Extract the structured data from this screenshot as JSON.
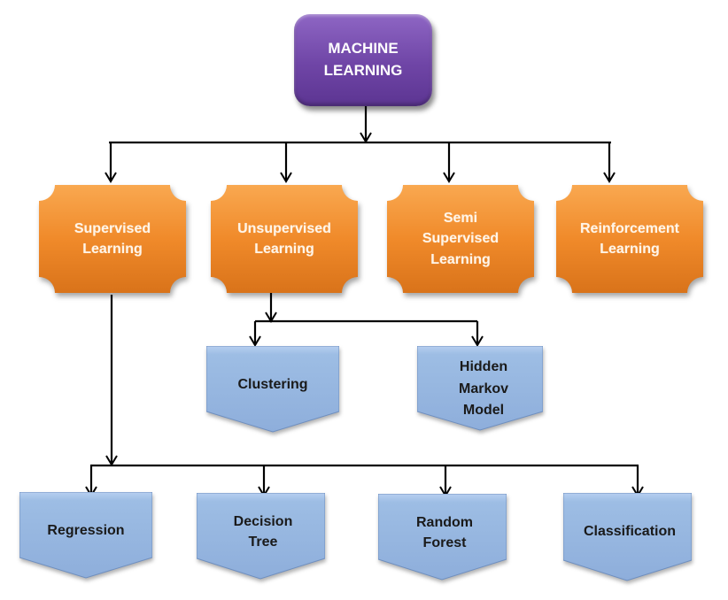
{
  "diagram": {
    "type": "hierarchy",
    "root": {
      "id": "ml",
      "label": "MACHINE\nLEARNING",
      "color": "#7c52b4"
    },
    "categories": [
      {
        "id": "supervised",
        "label": "Supervised\nLearning",
        "color": "#f08a2a"
      },
      {
        "id": "unsupervised",
        "label": "Unsupervised\nLearning",
        "color": "#f08a2a"
      },
      {
        "id": "semi",
        "label": "Semi\nSupervised\nLearning",
        "color": "#f08a2a"
      },
      {
        "id": "reinforcement",
        "label": "Reinforcement\nLearning",
        "color": "#f08a2a"
      }
    ],
    "unsupervised_children": [
      {
        "id": "clustering",
        "label": "Clustering",
        "color": "#9dbde4"
      },
      {
        "id": "hmm",
        "label": "Hidden\nMarkov\nModel",
        "color": "#9dbde4"
      }
    ],
    "supervised_children": [
      {
        "id": "regression",
        "label": "Regression",
        "color": "#9dbde4"
      },
      {
        "id": "decision-tree",
        "label": "Decision\nTree",
        "color": "#9dbde4"
      },
      {
        "id": "random-forest",
        "label": "Random\nForest",
        "color": "#9dbde4"
      },
      {
        "id": "classification",
        "label": "Classification",
        "color": "#9dbde4"
      }
    ],
    "edges": [
      [
        "ml",
        "supervised"
      ],
      [
        "ml",
        "unsupervised"
      ],
      [
        "ml",
        "semi"
      ],
      [
        "ml",
        "reinforcement"
      ],
      [
        "unsupervised",
        "clustering"
      ],
      [
        "unsupervised",
        "hmm"
      ],
      [
        "supervised",
        "regression"
      ],
      [
        "supervised",
        "decision-tree"
      ],
      [
        "supervised",
        "random-forest"
      ],
      [
        "supervised",
        "classification"
      ]
    ]
  }
}
